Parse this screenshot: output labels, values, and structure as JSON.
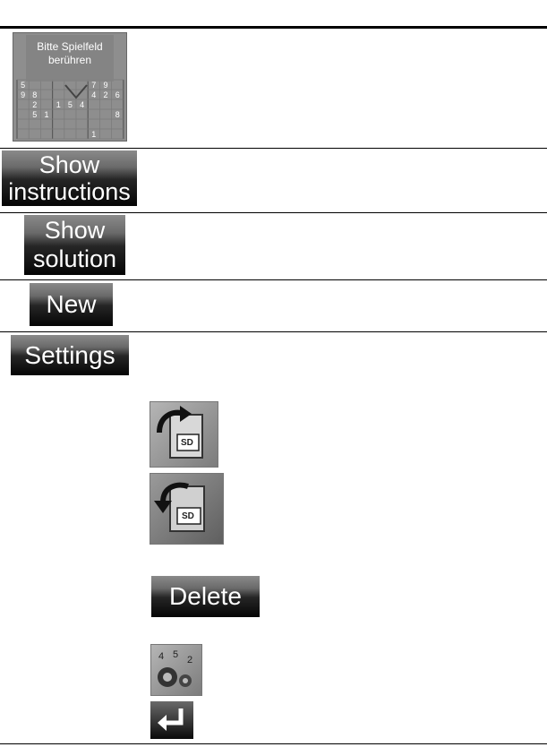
{
  "sudoku_preview": {
    "caption_line1": "Bitte Spielfeld",
    "caption_line2": "berühren",
    "digits": [
      {
        "row": 0,
        "col": 0,
        "v": "5"
      },
      {
        "row": 0,
        "col": 6,
        "v": "7"
      },
      {
        "row": 0,
        "col": 7,
        "v": "9"
      },
      {
        "row": 1,
        "col": 0,
        "v": "9"
      },
      {
        "row": 1,
        "col": 1,
        "v": "8"
      },
      {
        "row": 1,
        "col": 6,
        "v": "4"
      },
      {
        "row": 1,
        "col": 7,
        "v": "2"
      },
      {
        "row": 1,
        "col": 8,
        "v": "6"
      },
      {
        "row": 2,
        "col": 1,
        "v": "2"
      },
      {
        "row": 2,
        "col": 3,
        "v": "1"
      },
      {
        "row": 2,
        "col": 4,
        "v": "5"
      },
      {
        "row": 2,
        "col": 5,
        "v": "4"
      },
      {
        "row": 3,
        "col": 1,
        "v": "5"
      },
      {
        "row": 3,
        "col": 2,
        "v": "1"
      },
      {
        "row": 3,
        "col": 8,
        "v": "8"
      },
      {
        "row": 5,
        "col": 6,
        "v": "1"
      }
    ]
  },
  "buttons": {
    "instructions": {
      "line1": "Show",
      "line2": "instructions"
    },
    "solution": {
      "line1": "Show",
      "line2": "solution"
    },
    "new": {
      "label": "New"
    },
    "settings": {
      "label": "Settings"
    },
    "delete": {
      "label": "Delete"
    }
  },
  "icons": {
    "save_to_sd": {
      "name": "save-to-sd-icon",
      "text": "SD"
    },
    "load_from_sd": {
      "name": "load-from-sd-icon",
      "text": "SD"
    },
    "settings_gears": {
      "name": "settings-gears-icon",
      "text": "4 2 5"
    },
    "enter": {
      "name": "enter-return-icon"
    }
  }
}
